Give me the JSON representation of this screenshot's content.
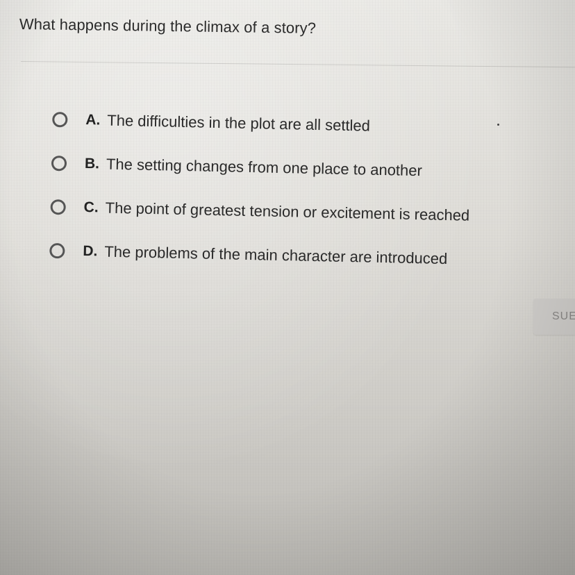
{
  "question": {
    "text": "What happens during the climax of a story?"
  },
  "choices": [
    {
      "letter": "A.",
      "text": "The difficulties in the plot are all settled"
    },
    {
      "letter": "B.",
      "text": "The setting changes from one place to another"
    },
    {
      "letter": "C.",
      "text": "The point of greatest tension or excitement is reached"
    },
    {
      "letter": "D.",
      "text": "The problems of the main character are introduced"
    }
  ],
  "submit": {
    "label": "SUE"
  },
  "colors": {
    "text": "#2b2b2b",
    "radio_border": "#555555",
    "button_bg": "#cfcdca",
    "button_text": "#8a8886"
  }
}
